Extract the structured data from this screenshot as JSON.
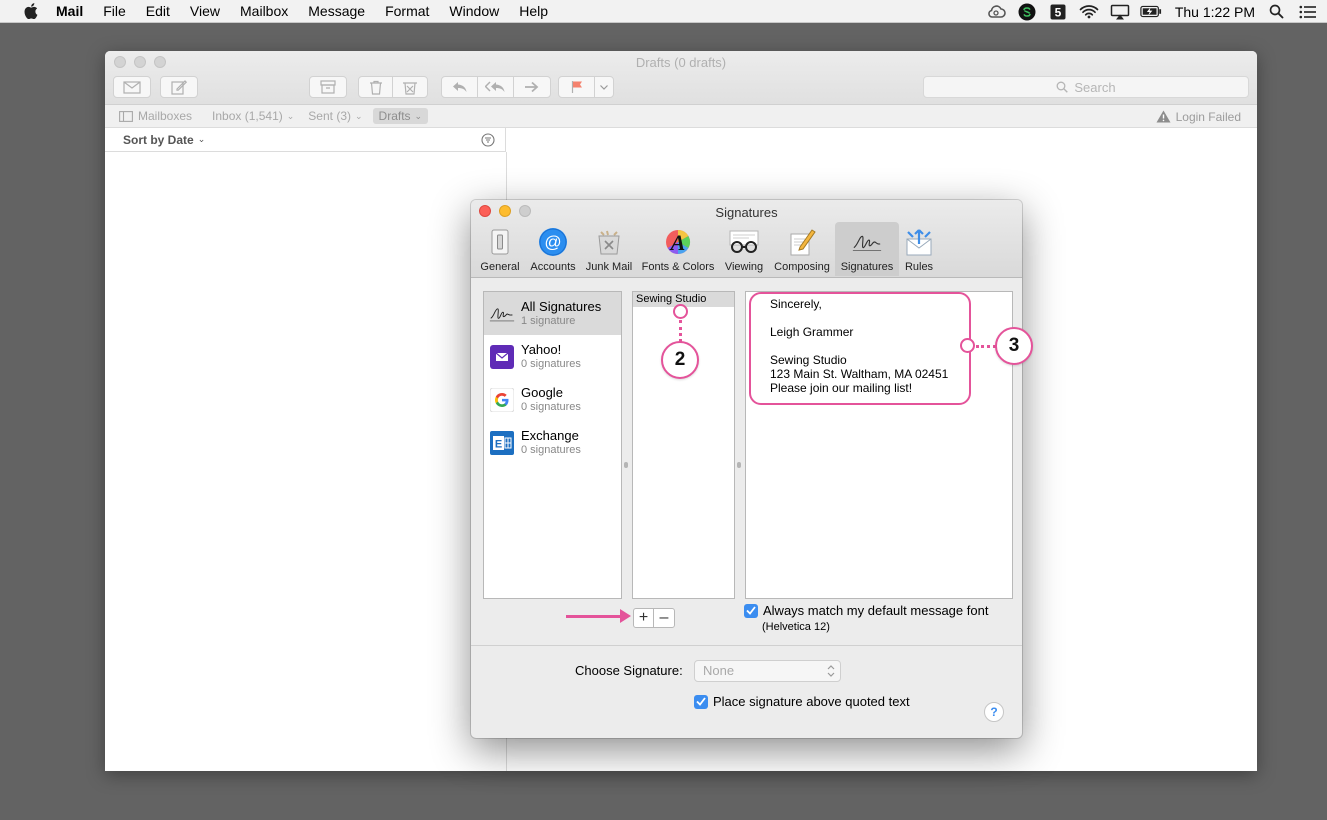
{
  "menubar": {
    "app_name": "Mail",
    "items": [
      "File",
      "Edit",
      "View",
      "Mailbox",
      "Message",
      "Format",
      "Window",
      "Help"
    ],
    "clock": "Thu 1:22 PM"
  },
  "mail_window": {
    "title": "Drafts (0 drafts)",
    "search_placeholder": "Search",
    "favorites": {
      "mailboxes": "Mailboxes",
      "inbox": "Inbox (1,541)",
      "sent": "Sent (3)",
      "drafts": "Drafts"
    },
    "login_status": "Login Failed",
    "sort_label": "Sort by Date"
  },
  "prefs": {
    "title": "Signatures",
    "tabs": [
      "General",
      "Accounts",
      "Junk Mail",
      "Fonts & Colors",
      "Viewing",
      "Composing",
      "Signatures",
      "Rules"
    ],
    "selected_tab": "Signatures",
    "accounts": [
      {
        "name": "All Signatures",
        "count": "1 signature"
      },
      {
        "name": "Yahoo!",
        "count": "0 signatures"
      },
      {
        "name": "Google",
        "count": "0 signatures"
      },
      {
        "name": "Exchange",
        "count": "0 signatures"
      }
    ],
    "signatures": [
      "Sewing Studio"
    ],
    "signature_body": {
      "line1": "Sincerely,",
      "line2": "Leigh Grammer",
      "line3": "Sewing Studio",
      "line4": "123 Main St. Waltham, MA 02451",
      "line5": "Please join our mailing list!"
    },
    "plus_label": "+",
    "minus_label": "–",
    "match_font_label": "Always match my default message font",
    "match_font_checked": true,
    "font_note": "(Helvetica 12)",
    "choose_signature_label": "Choose Signature:",
    "choose_signature_value": "None",
    "place_above_label": "Place signature above quoted text",
    "place_above_checked": true,
    "help_label": "?"
  },
  "callouts": {
    "badge2": "2",
    "badge3": "3"
  },
  "colors": {
    "callout": "#e4539a",
    "checkbox": "#3b8df0",
    "desktop": "#636363"
  }
}
